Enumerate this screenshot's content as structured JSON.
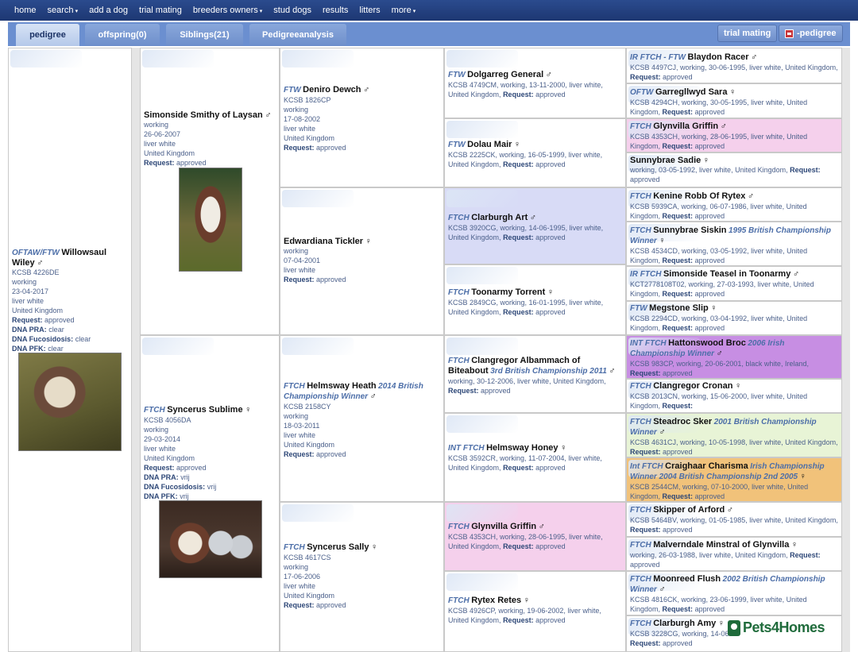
{
  "nav": {
    "items": [
      {
        "label": "home",
        "caret": ""
      },
      {
        "label": "search",
        "caret": "▾"
      },
      {
        "label": "add a dog",
        "caret": ""
      },
      {
        "label": "trial mating",
        "caret": ""
      },
      {
        "label": "breeders owners",
        "caret": "▾"
      },
      {
        "label": "stud dogs",
        "caret": ""
      },
      {
        "label": "results",
        "caret": ""
      },
      {
        "label": "litters",
        "caret": ""
      },
      {
        "label": "more",
        "caret": "▾"
      }
    ]
  },
  "tabs": [
    {
      "label": "pedigree",
      "active": true
    },
    {
      "label": "offspring(0)",
      "active": false
    },
    {
      "label": "Siblings(21)",
      "active": false
    },
    {
      "label": "Pedigreeanalysis",
      "active": false
    }
  ],
  "actions": {
    "trial_mating": "trial mating",
    "pdf_pedigree": "-pedigree"
  },
  "dogs": {
    "d0": {
      "title": "OFTAW/FTW",
      "name": "Willowsaul Wiley",
      "sex": "♂",
      "reg": "KCSB 4226DE",
      "work": "working",
      "dob": "23-04-2017",
      "colour": "liver white",
      "country": "United Kingdom",
      "request_label": "Request:",
      "request": "approved",
      "dna1_label": "DNA PRA:",
      "dna1": "clear",
      "dna2_label": "DNA Fucosidosis:",
      "dna2": "clear",
      "dna3_label": "DNA PFK:",
      "dna3": "clear"
    },
    "d1": {
      "title": "",
      "name": "Simonside Smithy of Laysan",
      "sex": "♂",
      "work": "working",
      "dob": "26-06-2007",
      "colour": "liver white",
      "country": "United Kingdom",
      "request_label": "Request:",
      "request": "approved"
    },
    "d2": {
      "title": "FTCH",
      "name": "Syncerus Sublime",
      "sex": "♀",
      "reg": "KCSB 4056DA",
      "work": "working",
      "dob": "29-03-2014",
      "colour": "liver white",
      "country": "United Kingdom",
      "request_label": "Request:",
      "request": "approved",
      "dna1_label": "DNA PRA:",
      "dna1": "vrij",
      "dna2_label": "DNA Fucosidosis:",
      "dna2": "vrij",
      "dna3_label": "DNA PFK:",
      "dna3": "vrij"
    },
    "d3": {
      "title": "FTW",
      "name": "Deniro Dewch",
      "sex": "♂",
      "reg": "KCSB 1826CP",
      "work": "working",
      "dob": "17-08-2002",
      "colour": "liver white",
      "country": "United Kingdom",
      "request_label": "Request:",
      "request": "approved"
    },
    "d4": {
      "title": "",
      "name": "Edwardiana Tickler",
      "sex": "♀",
      "work": "working",
      "dob": "07-04-2001",
      "colour": "liver white",
      "request_label": "Request:",
      "request": "approved"
    },
    "d5": {
      "title": "FTCH",
      "name": "Helmsway Heath",
      "ach": "2014 British Championship Winner",
      "sex": "♂",
      "reg": "KCSB 2158CY",
      "work": "working",
      "dob": "18-03-2011",
      "colour": "liver white",
      "country": "United Kingdom",
      "request_label": "Request:",
      "request": "approved"
    },
    "d6": {
      "title": "FTCH",
      "name": "Syncerus Sally",
      "sex": "♀",
      "reg": "KCSB 4617CS",
      "work": "working",
      "dob": "17-06-2006",
      "colour": "liver white",
      "country": "United Kingdom",
      "request_label": "Request:",
      "request": "approved"
    },
    "g1": {
      "title": "FTW",
      "name": "Dolgarreg General",
      "sex": "♂",
      "info": "KCSB 4749CM, working, 13-11-2000, liver white, United Kingdom,",
      "request_label": "Request:",
      "request": "approved"
    },
    "g2": {
      "title": "FTW",
      "name": "Dolau Mair",
      "sex": "♀",
      "info": "KCSB 2225CK, working, 16-05-1999, liver white, United Kingdom,",
      "request_label": "Request:",
      "request": "approved"
    },
    "g3": {
      "title": "FTCH",
      "name": "Clarburgh Art",
      "sex": "♂",
      "info": "KCSB 3920CG, working, 14-06-1995, liver white, United Kingdom,",
      "request_label": "Request:",
      "request": "approved"
    },
    "g4": {
      "title": "FTCH",
      "name": "Toonarmy Torrent",
      "sex": "♀",
      "info": "KCSB 2849CG, working, 16-01-1995, liver white, United Kingdom,",
      "request_label": "Request:",
      "request": "approved"
    },
    "g5": {
      "title": "FTCH",
      "name": "Clangregor Albammach of Biteabout",
      "ach": "3rd British Championship 2011",
      "sex": "♂",
      "info": "working, 30-12-2006, liver white, United Kingdom,",
      "request_label": "Request:",
      "request": "approved"
    },
    "g6": {
      "title": "INT FTCH",
      "name": "Helmsway Honey",
      "sex": "♀",
      "info": "KCSB 3592CR, working, 11-07-2004, liver white, United Kingdom,",
      "request_label": "Request:",
      "request": "approved"
    },
    "g7": {
      "title": "FTCH",
      "name": "Glynvilla Griffin",
      "sex": "♂",
      "info": "KCSB 4353CH, working, 28-06-1995, liver white, United Kingdom,",
      "request_label": "Request:",
      "request": "approved"
    },
    "g8": {
      "title": "FTCH",
      "name": "Rytex Retes",
      "sex": "♀",
      "info": "KCSB 4926CP, working, 19-06-2002, liver white, United Kingdom,",
      "request_label": "Request:",
      "request": "approved"
    },
    "h1": {
      "title": "IR FTCH - FTW",
      "name": "Blaydon Racer",
      "sex": "♂",
      "info": "KCSB 4497CJ, working, 30-06-1995, liver white, United Kingdom,",
      "request_label": "Request:",
      "request": "approved"
    },
    "h2": {
      "title": "OFTW",
      "name": "Garregllwyd Sara",
      "sex": "♀",
      "info": "KCSB 4294CH, working, 30-05-1995, liver white, United Kingdom,",
      "request_label": "Request:",
      "request": "approved"
    },
    "h3": {
      "title": "FTCH",
      "name": "Glynvilla Griffin",
      "sex": "♂",
      "info": "KCSB 4353CH, working, 28-06-1995, liver white, United Kingdom,",
      "request_label": "Request:",
      "request": "approved"
    },
    "h4": {
      "title": "",
      "name": "Sunnybrae Sadie",
      "sex": "♀",
      "info": "working, 03-05-1992, liver white, United Kingdom,",
      "request_label": "Request:",
      "request": "approved"
    },
    "h5": {
      "title": "FTCH",
      "name": "Kenine Robb Of Rytex",
      "sex": "♂",
      "info": "KCSB 5939CA, working, 06-07-1986, liver white, United Kingdom,",
      "request_label": "Request:",
      "request": "approved"
    },
    "h6": {
      "title": "FTCH",
      "name": "Sunnybrae Siskin",
      "ach": "1995 British Championship Winner",
      "sex": "♀",
      "info": "KCSB 4534CD, working, 03-05-1992, liver white, United Kingdom,",
      "request_label": "Request:",
      "request": "approved"
    },
    "h7": {
      "title": "IR FTCH",
      "name": "Simonside Teasel in Toonarmy",
      "sex": "♂",
      "info": "KCT2778108T02, working, 27-03-1993, liver white, United Kingdom,",
      "request_label": "Request:",
      "request": "approved"
    },
    "h8": {
      "title": "FTW",
      "name": "Megstone Slip",
      "sex": "♀",
      "info": "KCSB 2294CD, working, 03-04-1992, liver white, United Kingdom,",
      "request_label": "Request:",
      "request": "approved"
    },
    "h9": {
      "title": "INT FTCH",
      "name": "Hattonswood Broc",
      "ach": "2006 Irish Championship Winner",
      "sex": "♂",
      "info": "KCSB 983CP, working, 20-06-2001, black white, Ireland,",
      "request_label": "Request:",
      "request": "approved"
    },
    "h10": {
      "title": "FTCH",
      "name": "Clangregor Cronan",
      "sex": "♀",
      "info": "KCSB 2013CN, working, 15-06-2000, liver white, United Kingdom,",
      "request_label": "Request:",
      "request": ""
    },
    "h11": {
      "title": "FTCH",
      "name": "Steadroc Sker",
      "ach": "2001 British Championship Winner",
      "sex": "♂",
      "info": "KCSB 4631CJ, working, 10-05-1998, liver white, United Kingdom,",
      "request_label": "Request:",
      "request": "approved"
    },
    "h12": {
      "title": "Int FTCH",
      "name": "Craighaar Charisma",
      "ach": "Irish Championship Winner 2004 British Championship 2nd 2005",
      "sex": "♀",
      "info": "KSCB 2544CM, working, 07-10-2000, liver white, United Kingdom,",
      "request_label": "Request:",
      "request": "approved"
    },
    "h13": {
      "title": "FTCH",
      "name": "Skipper of Arford",
      "sex": "♂",
      "info": "KCSB 5464BV, working, 01-05-1985, liver white, United Kingdom,",
      "request_label": "Request:",
      "request": "approved"
    },
    "h14": {
      "title": "FTCH",
      "name": "Malverndale Minstral of Glynvilla",
      "sex": "♀",
      "info": "working, 26-03-1988, liver white, United Kingdom,",
      "request_label": "Request:",
      "request": "approved"
    },
    "h15": {
      "title": "FTCH",
      "name": "Moonreed Flush",
      "ach": "2002 British Championship Winner",
      "sex": "♂",
      "info": "KCSB 4816CK, working, 23-06-1999, liver white, United Kingdom,",
      "request_label": "Request:",
      "request": "approved"
    },
    "h16": {
      "title": "FTCH",
      "name": "Clarburgh Amy",
      "sex": "♀",
      "info": "KCSB 3228CG, working, 14-06-",
      "request_label": "Request:",
      "request": "approved"
    }
  },
  "watermark": "Pets4Homes",
  "colors": {
    "nav_bg": "#1d3772",
    "tab_bar": "#6b8fd0",
    "pink": "#f5d0ec",
    "lavender": "#d8dbf6",
    "purple": "#c78ee3",
    "green": "#e8f4d6",
    "orange": "#f1c27a"
  }
}
